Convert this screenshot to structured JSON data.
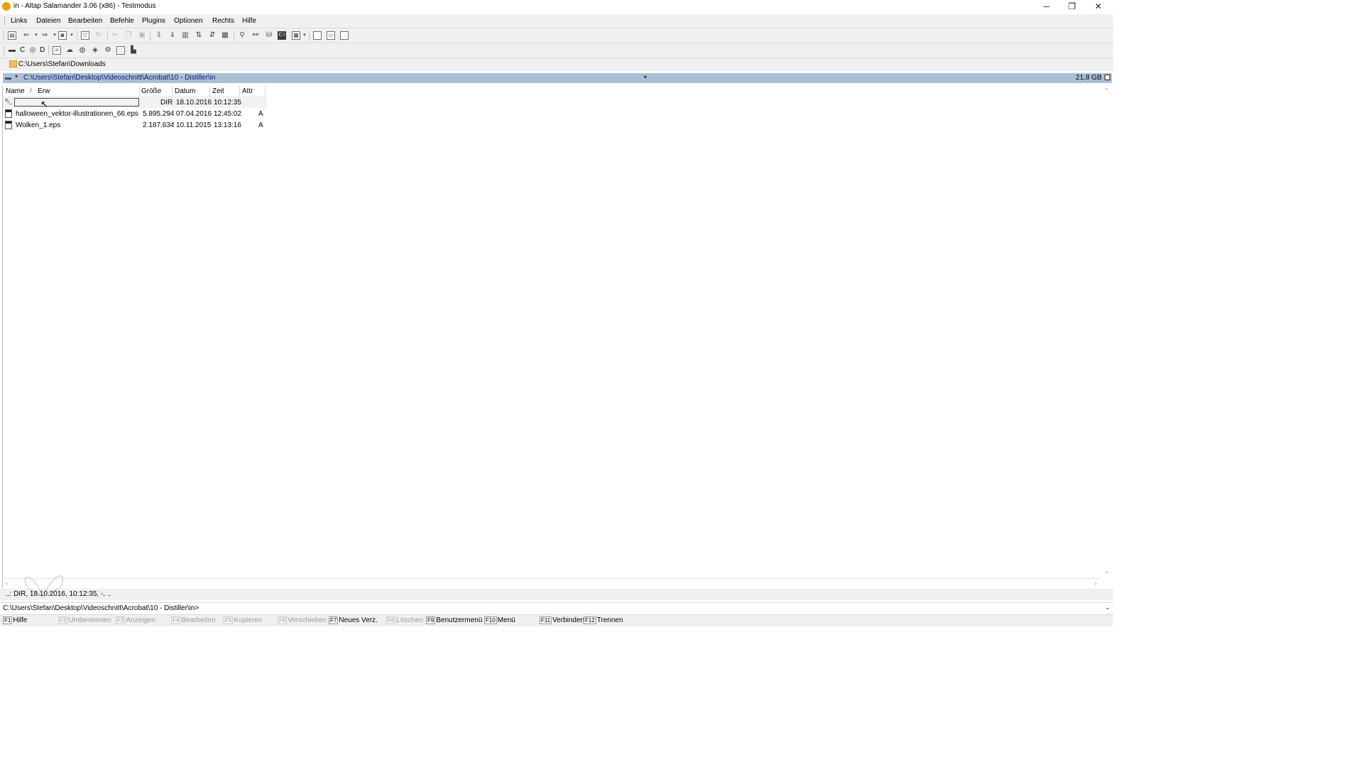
{
  "window": {
    "title": "in - Altap Salamander 3.06 (x86) - Testmodus",
    "controls": {
      "minimize": "─",
      "maximize": "❐",
      "close": "✕"
    }
  },
  "menu": [
    "Links",
    "Dateien",
    "Bearbeiten",
    "Befehle",
    "Plugins",
    "Optionen",
    "Rechts",
    "Hilfe"
  ],
  "drives": {
    "c": "C",
    "d": "D"
  },
  "dirline": {
    "path": "C:\\Users\\Stefan\\Downloads"
  },
  "panel": {
    "path": "C:\\Users\\Stefan\\Desktop\\Videoschnitt\\Acrobat\\10 - Distiller\\in",
    "free_space": "21,8 GB",
    "columns": {
      "name": "Name",
      "sort": "/",
      "ext": "Erw",
      "size": "Größe",
      "date": "Datum",
      "time": "Zeit",
      "attr": "Attr"
    },
    "rows": [
      {
        "name": "..",
        "size": "DIR",
        "date": "18.10.2016",
        "time": "10:12:35",
        "attr": "",
        "type": "updir"
      },
      {
        "name": "halloween_vektor-illustrationen_66.eps",
        "size": "5.895.294",
        "date": "07.04.2016",
        "time": "12:45:02",
        "attr": "A",
        "type": "file"
      },
      {
        "name": "Wolken_1.eps",
        "size": "2.187.634",
        "date": "10.11.2015",
        "time": "13:13:16",
        "attr": "A",
        "type": "file"
      }
    ]
  },
  "infoline": {
    "text": "..: DIR, 18.10.2016, 10:12:35, -, .."
  },
  "cmdline": {
    "text": "C:\\Users\\Stefan\\Desktop\\Videoschnitt\\Acrobat\\10 - Distiller\\in>"
  },
  "fkeys": [
    {
      "key": "F1",
      "label": "Hilfe",
      "enabled": true
    },
    {
      "key": "F2",
      "label": "Umbenennen",
      "enabled": false
    },
    {
      "key": "F3",
      "label": "Anzeigen",
      "enabled": false
    },
    {
      "key": "F4",
      "label": "Bearbeiten",
      "enabled": false
    },
    {
      "key": "F5",
      "label": "Kopieren",
      "enabled": false
    },
    {
      "key": "F6",
      "label": "Verschieben",
      "enabled": false
    },
    {
      "key": "F7",
      "label": "Neues Verz.",
      "enabled": true
    },
    {
      "key": "F8",
      "label": "Löschen",
      "enabled": false
    },
    {
      "key": "F9",
      "label": "Benutzermenü",
      "enabled": true
    },
    {
      "key": "F10",
      "label": "Menü",
      "enabled": true
    },
    {
      "key": "F11",
      "label": "Verbinden",
      "enabled": true
    },
    {
      "key": "F12",
      "label": "Trennen",
      "enabled": true
    }
  ],
  "colors": {
    "path_bar_bg": "#abbfd6",
    "path_text": "#0b1a6c",
    "disabled_text": "#9b9b9b"
  }
}
